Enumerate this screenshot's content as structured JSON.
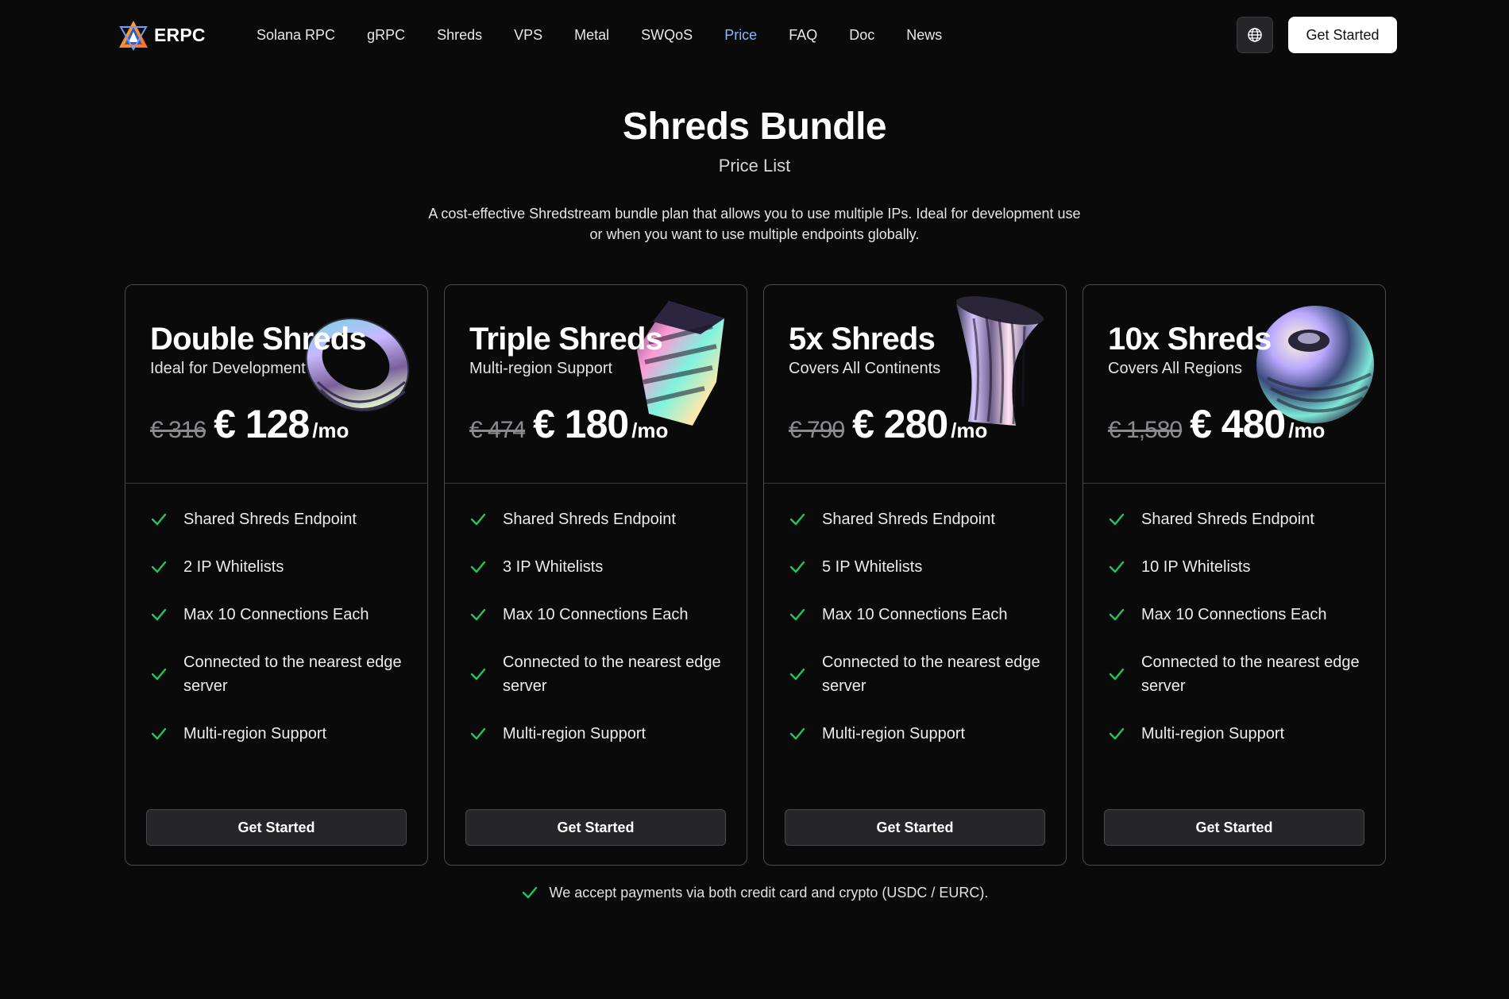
{
  "brand": {
    "name": "ERPC"
  },
  "nav": {
    "items": [
      {
        "label": "Solana RPC",
        "active": false
      },
      {
        "label": "gRPC",
        "active": false
      },
      {
        "label": "Shreds",
        "active": false
      },
      {
        "label": "VPS",
        "active": false
      },
      {
        "label": "Metal",
        "active": false
      },
      {
        "label": "SWQoS",
        "active": false
      },
      {
        "label": "Price",
        "active": true
      },
      {
        "label": "FAQ",
        "active": false
      },
      {
        "label": "Doc",
        "active": false
      },
      {
        "label": "News",
        "active": false
      }
    ],
    "language_icon": "globe-icon",
    "cta_label": "Get Started"
  },
  "hero": {
    "title": "Shreds Bundle",
    "subtitle": "Price List",
    "description": "A cost-effective Shredstream bundle plan that allows you to use multiple IPs. Ideal for development use or when you want to use multiple endpoints globally."
  },
  "plans": [
    {
      "title": "Double Shreds",
      "tagline": "Ideal for Development",
      "old_price": "€ 316",
      "price": "€ 128",
      "period": "/mo",
      "art_icon": "ring-icon",
      "features": [
        "Shared Shreds Endpoint",
        "2 IP Whitelists",
        "Max 10 Connections Each",
        "Connected to the nearest edge server",
        "Multi-region Support"
      ],
      "cta_label": "Get Started"
    },
    {
      "title": "Triple Shreds",
      "tagline": "Multi-region Support",
      "old_price": "€ 474",
      "price": "€ 180",
      "period": "/mo",
      "art_icon": "twisted-prism-icon",
      "features": [
        "Shared Shreds Endpoint",
        "3 IP Whitelists",
        "Max 10 Connections Each",
        "Connected to the nearest edge server",
        "Multi-region Support"
      ],
      "cta_label": "Get Started"
    },
    {
      "title": "5x Shreds",
      "tagline": "Covers All Continents",
      "old_price": "€ 790",
      "price": "€ 280",
      "period": "/mo",
      "art_icon": "fluted-vase-icon",
      "features": [
        "Shared Shreds Endpoint",
        "5 IP Whitelists",
        "Max 10 Connections Each",
        "Connected to the nearest edge server",
        "Multi-region Support"
      ],
      "cta_label": "Get Started"
    },
    {
      "title": "10x Shreds",
      "tagline": "Covers All Regions",
      "old_price": "€ 1,580",
      "price": "€ 480",
      "period": "/mo",
      "art_icon": "sphere-icon",
      "features": [
        "Shared Shreds Endpoint",
        "10 IP Whitelists",
        "Max 10 Connections Each",
        "Connected to the nearest edge server",
        "Multi-region Support"
      ],
      "cta_label": "Get Started"
    }
  ],
  "footnote": "We accept payments via both credit card and crypto (USDC / EURC).",
  "colors": {
    "background": "#0a0a0b",
    "accent_nav_active": "#8fb6f7",
    "check_green": "#22c55e",
    "card_border": "#4a4a4f"
  }
}
